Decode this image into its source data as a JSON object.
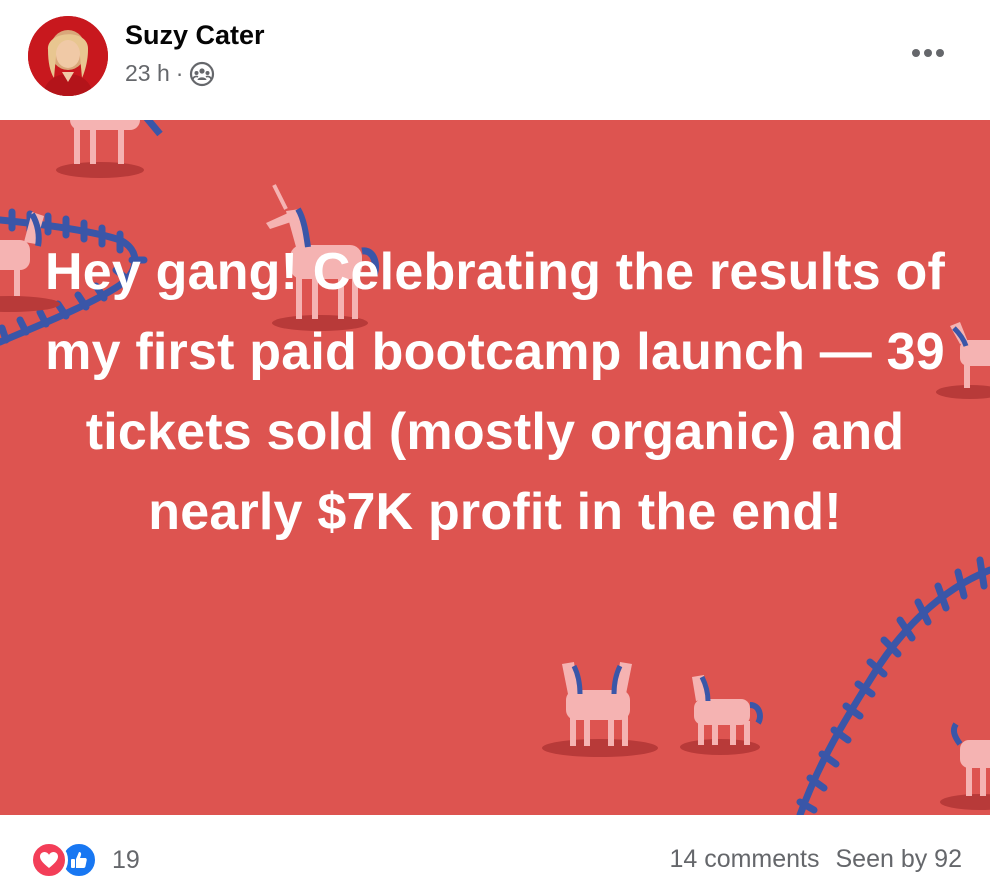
{
  "post": {
    "author": "Suzy Cater",
    "timestamp": "23 h",
    "separator": "·",
    "audience_icon": "group-icon",
    "more_icon": "more-options-icon",
    "text": "Hey gang! Celebrating the results of my first paid bootcamp launch — 39 tickets sold (mostly organic) and nearly $7K profit in the end!",
    "background_color": "#dd5450",
    "theme_motif": "unicorns-and-fences"
  },
  "footer": {
    "reaction_icons": [
      "love-reaction-icon",
      "like-reaction-icon"
    ],
    "reaction_count": "19",
    "comments": "14 comments",
    "seen_by": "Seen by 92"
  },
  "colors": {
    "love": "#f33e58",
    "like": "#1877f2",
    "muted_text": "#65676b"
  }
}
